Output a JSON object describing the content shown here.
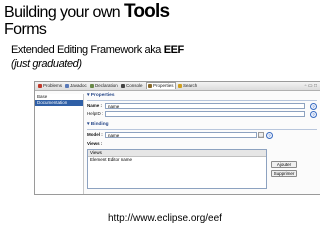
{
  "slide": {
    "title_prefix": "Building your own",
    "title_emph": "Tools",
    "subtitle": "Forms",
    "line1_text": "Extended Editing Framework aka",
    "line1_bold": "EEF",
    "line2": "(just graduated)",
    "url": "http://www.eclipse.org/eef"
  },
  "screenshot": {
    "tabs": [
      {
        "label": "Problems",
        "color": "#c0392b"
      },
      {
        "label": "Javadoc",
        "color": "#5a7ab8"
      },
      {
        "label": "Declaration",
        "color": "#6a8a4a"
      },
      {
        "label": "Console",
        "color": "#444444"
      },
      {
        "label": "Properties",
        "color": "#8a6a2a",
        "active": true
      },
      {
        "label": "Search",
        "color": "#d0a020"
      }
    ],
    "nav": {
      "items": [
        {
          "label": "Base",
          "selected": false
        },
        {
          "label": "Documentation",
          "selected": true
        }
      ]
    },
    "properties_section": {
      "title": "Properties",
      "name_label": "Name :",
      "name_value": "name",
      "helpid_label": "HelpID :",
      "helpid_value": ""
    },
    "binding_section": {
      "title": "Binding",
      "model_label": "Model :",
      "model_value": "name",
      "views_label": "Views :",
      "views_header": "Views",
      "views_items": [
        "Element Editor name"
      ],
      "add_button": "Ajouter",
      "remove_button": "Supprimer"
    }
  }
}
